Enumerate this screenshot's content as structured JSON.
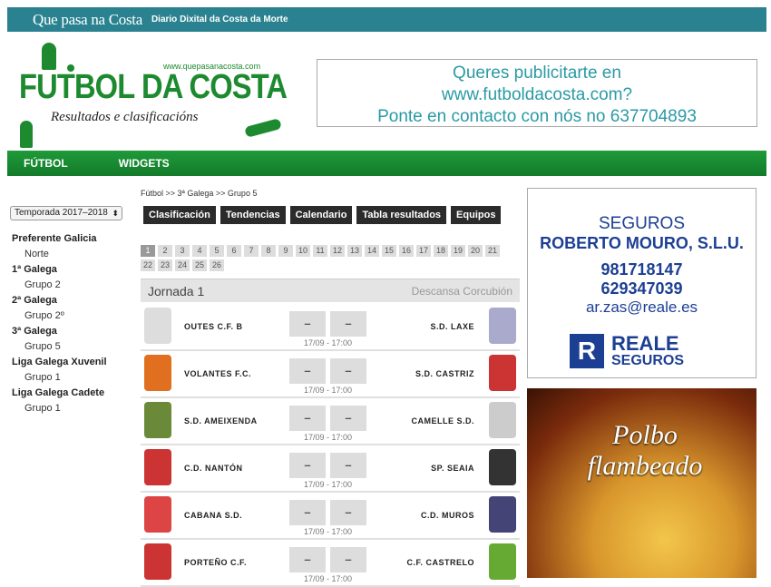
{
  "topbar": {
    "logo": "Que pasa na Costa",
    "tagline": "Diario Dixital da Costa da Morte"
  },
  "brand": {
    "title": "FUTBOL DA COSTA",
    "url": "www.quepasanacosta.com",
    "subtitle": "Resultados e clasificacións"
  },
  "ad_top": {
    "line1": "Queres publicitarte en",
    "line2": "www.futboldacosta.com?",
    "line3": "Ponte en contacto con nós no 637704893"
  },
  "nav": {
    "items": [
      "FÚTBOL",
      "WIDGETS"
    ]
  },
  "season": "Temporada 2017–2018",
  "sidebar": {
    "groups": [
      {
        "title": "Preferente Galicia",
        "items": [
          "Norte"
        ]
      },
      {
        "title": "1ª Galega",
        "items": [
          "Grupo 2"
        ]
      },
      {
        "title": "2ª Galega",
        "items": [
          "Grupo 2º"
        ]
      },
      {
        "title": "3ª Galega",
        "items": [
          "Grupo 5"
        ]
      },
      {
        "title": "Liga Galega Xuvenil",
        "items": [
          "Grupo 1"
        ]
      },
      {
        "title": "Liga Galega Cadete",
        "items": [
          "Grupo 1"
        ]
      }
    ]
  },
  "breadcrumb": [
    "Fútbol",
    ">> 3ª Galega",
    ">> Grupo 5"
  ],
  "tabs": [
    "Clasificación",
    "Tendencias",
    "Calendario",
    "Tabla resultados",
    "Equipos"
  ],
  "pages": [
    "1",
    "2",
    "3",
    "4",
    "5",
    "6",
    "7",
    "8",
    "9",
    "10",
    "11",
    "12",
    "13",
    "14",
    "15",
    "16",
    "17",
    "18",
    "19",
    "20",
    "21",
    "22",
    "23",
    "24",
    "25",
    "26"
  ],
  "jornada": {
    "title": "Jornada 1",
    "rest": "Descansa Corcubión"
  },
  "matches": [
    {
      "home": "OUTES C.F. B",
      "away": "S.D. LAXE",
      "hs": "–",
      "as": "–",
      "time": "17/09 - 17:00"
    },
    {
      "home": "VOLANTES F.C.",
      "away": "S.D. CASTRIZ",
      "hs": "–",
      "as": "–",
      "time": "17/09 - 17:00"
    },
    {
      "home": "S.D. AMEIXENDA",
      "away": "CAMELLE S.D.",
      "hs": "–",
      "as": "–",
      "time": "17/09 - 17:00"
    },
    {
      "home": "C.D. NANTÓN",
      "away": "SP. SEAIA",
      "hs": "–",
      "as": "–",
      "time": "17/09 - 17:00"
    },
    {
      "home": "CABANA S.D.",
      "away": "C.D. MUROS",
      "hs": "–",
      "as": "–",
      "time": "17/09 - 17:00"
    },
    {
      "home": "PORTEÑO C.F.",
      "away": "C.F. CASTRELO",
      "hs": "–",
      "as": "–",
      "time": "17/09 - 17:00"
    }
  ],
  "ad_seguros": {
    "line1": "SEGUROS",
    "line2": "ROBERTO MOURO, S.L.U.",
    "phone1": "981718147",
    "phone2": "629347039",
    "email": "ar.zas@reale.es",
    "logo_a": "REALE",
    "logo_b": "SEGUROS"
  },
  "ad_polbo": {
    "line1": "Polbo",
    "line2": "flambeado"
  }
}
